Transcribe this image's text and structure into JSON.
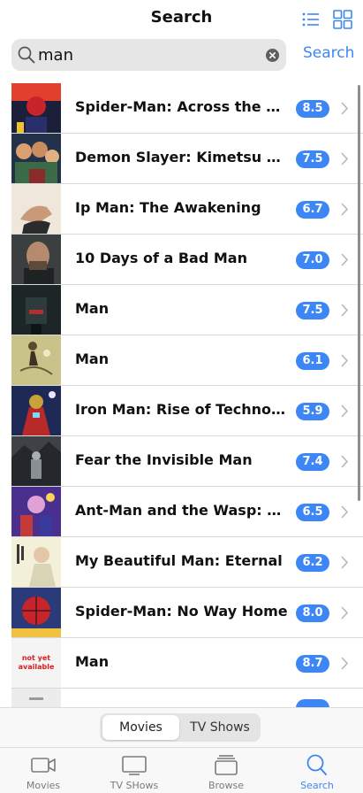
{
  "header": {
    "title": "Search",
    "list_view_icon": "list-icon",
    "grid_view_icon": "grid-icon"
  },
  "search": {
    "value": "man",
    "button_label": "Search",
    "search_icon": "magnifier-icon",
    "clear_icon": "clear-icon"
  },
  "results": [
    {
      "title": "Spider-Man: Across the Spider-Verse",
      "rating": "8.5",
      "poster": "poster-1"
    },
    {
      "title": "Demon Slayer: Kimetsu no Yaiba",
      "rating": "7.5",
      "poster": "poster-2"
    },
    {
      "title": "Ip Man: The Awakening",
      "rating": "6.7",
      "poster": "poster-3"
    },
    {
      "title": "10 Days of a Bad Man",
      "rating": "7.0",
      "poster": "poster-4"
    },
    {
      "title": "Man",
      "rating": "7.5",
      "poster": "poster-5"
    },
    {
      "title": "Man",
      "rating": "6.1",
      "poster": "poster-6"
    },
    {
      "title": "Iron Man: Rise of Technovore",
      "rating": "5.9",
      "poster": "poster-7"
    },
    {
      "title": "Fear the Invisible Man",
      "rating": "7.4",
      "poster": "poster-8"
    },
    {
      "title": "Ant-Man and the Wasp: Quantumania",
      "rating": "6.5",
      "poster": "poster-9"
    },
    {
      "title": "My Beautiful Man: Eternal",
      "rating": "6.2",
      "poster": "poster-10"
    },
    {
      "title": "Spider-Man: No Way Home",
      "rating": "8.0",
      "poster": "poster-11"
    },
    {
      "title": "Man",
      "rating": "8.7",
      "poster": "not yet available"
    },
    {
      "title": "",
      "rating": "",
      "poster": "poster-13"
    }
  ],
  "segmented": {
    "movies_label": "Movies",
    "tv_label": "TV Shows",
    "selected": "Movies"
  },
  "tabbar": {
    "movies": "Movies",
    "tv_shows": "TV SHows",
    "browse": "Browse",
    "search": "Search",
    "active": "Search"
  },
  "colors": {
    "accent": "#3d86f5",
    "rating_badge": "#3d86f5"
  }
}
